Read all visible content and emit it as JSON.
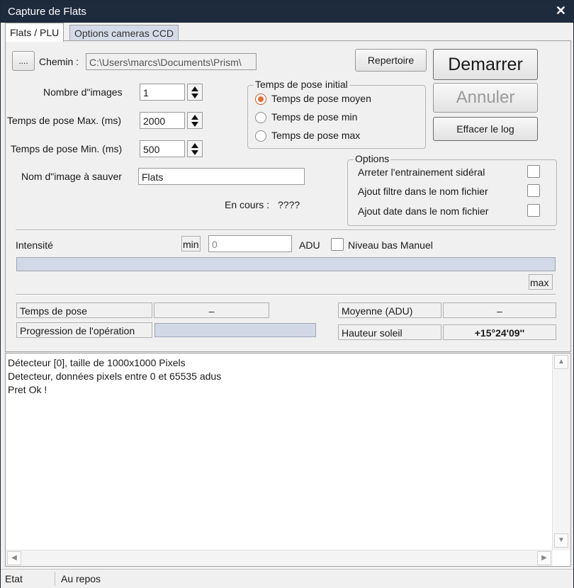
{
  "window": {
    "title": "Capture de Flats",
    "close": "✕"
  },
  "tabs": [
    {
      "label": "Flats / PLU"
    },
    {
      "label": "Options cameras CCD"
    }
  ],
  "path": {
    "browse_label": "....",
    "label": "Chemin :",
    "value": "C:\\Users\\marcs\\Documents\\Prism\\"
  },
  "buttons": {
    "repertoire": "Repertoire",
    "demarrer": "Demarrer",
    "annuler": "Annuler",
    "effacer_log": "Effacer le log"
  },
  "fields": {
    "nb_images": {
      "label": "Nombre d\"images",
      "value": "1"
    },
    "pose_max": {
      "label": "Temps de pose Max. (ms)",
      "value": "2000"
    },
    "pose_min": {
      "label": "Temps de pose Min. (ms)",
      "value": "500"
    },
    "nom_image": {
      "label": "Nom d\"image à sauver",
      "value": "Flats"
    }
  },
  "pose_initial": {
    "legend": "Temps de pose initial",
    "options": [
      {
        "label": "Temps de pose moyen",
        "selected": true
      },
      {
        "label": "Temps de pose min",
        "selected": false
      },
      {
        "label": "Temps de pose max",
        "selected": false
      }
    ]
  },
  "options_group": {
    "legend": "Options",
    "items": [
      {
        "label": "Arreter l'entrainement sidéral",
        "checked": false
      },
      {
        "label": "Ajout filtre dans le nom fichier",
        "checked": false
      },
      {
        "label": "Ajout date dans le nom fichier",
        "checked": false
      }
    ]
  },
  "en_cours": {
    "label": "En cours :",
    "value": "????"
  },
  "intensite": {
    "label": "Intensité",
    "min_label": "min",
    "min_value": "0",
    "unit": "ADU",
    "manuel_label": "Niveau bas Manuel",
    "max_label": "max"
  },
  "stats": {
    "temps_pose_label": "Temps de pose",
    "temps_pose_value": "–",
    "progression_label": "Progression de l'opération",
    "moyenne_label": "Moyenne (ADU)",
    "moyenne_value": "–",
    "hauteur_label": "Hauteur soleil",
    "hauteur_value": "+15°24'09''"
  },
  "log": [
    "Détecteur [0], taille de 1000x1000 Pixels",
    "Detecteur, données pixels entre 0 et 65535 adus",
    "Pret Ok !"
  ],
  "statusbar": {
    "label": "Etat",
    "value": "Au repos"
  },
  "colors": {
    "title_bg": "#1e2b3d",
    "radio_accent": "#e0703a",
    "bar_fill": "#d3d8e6"
  }
}
